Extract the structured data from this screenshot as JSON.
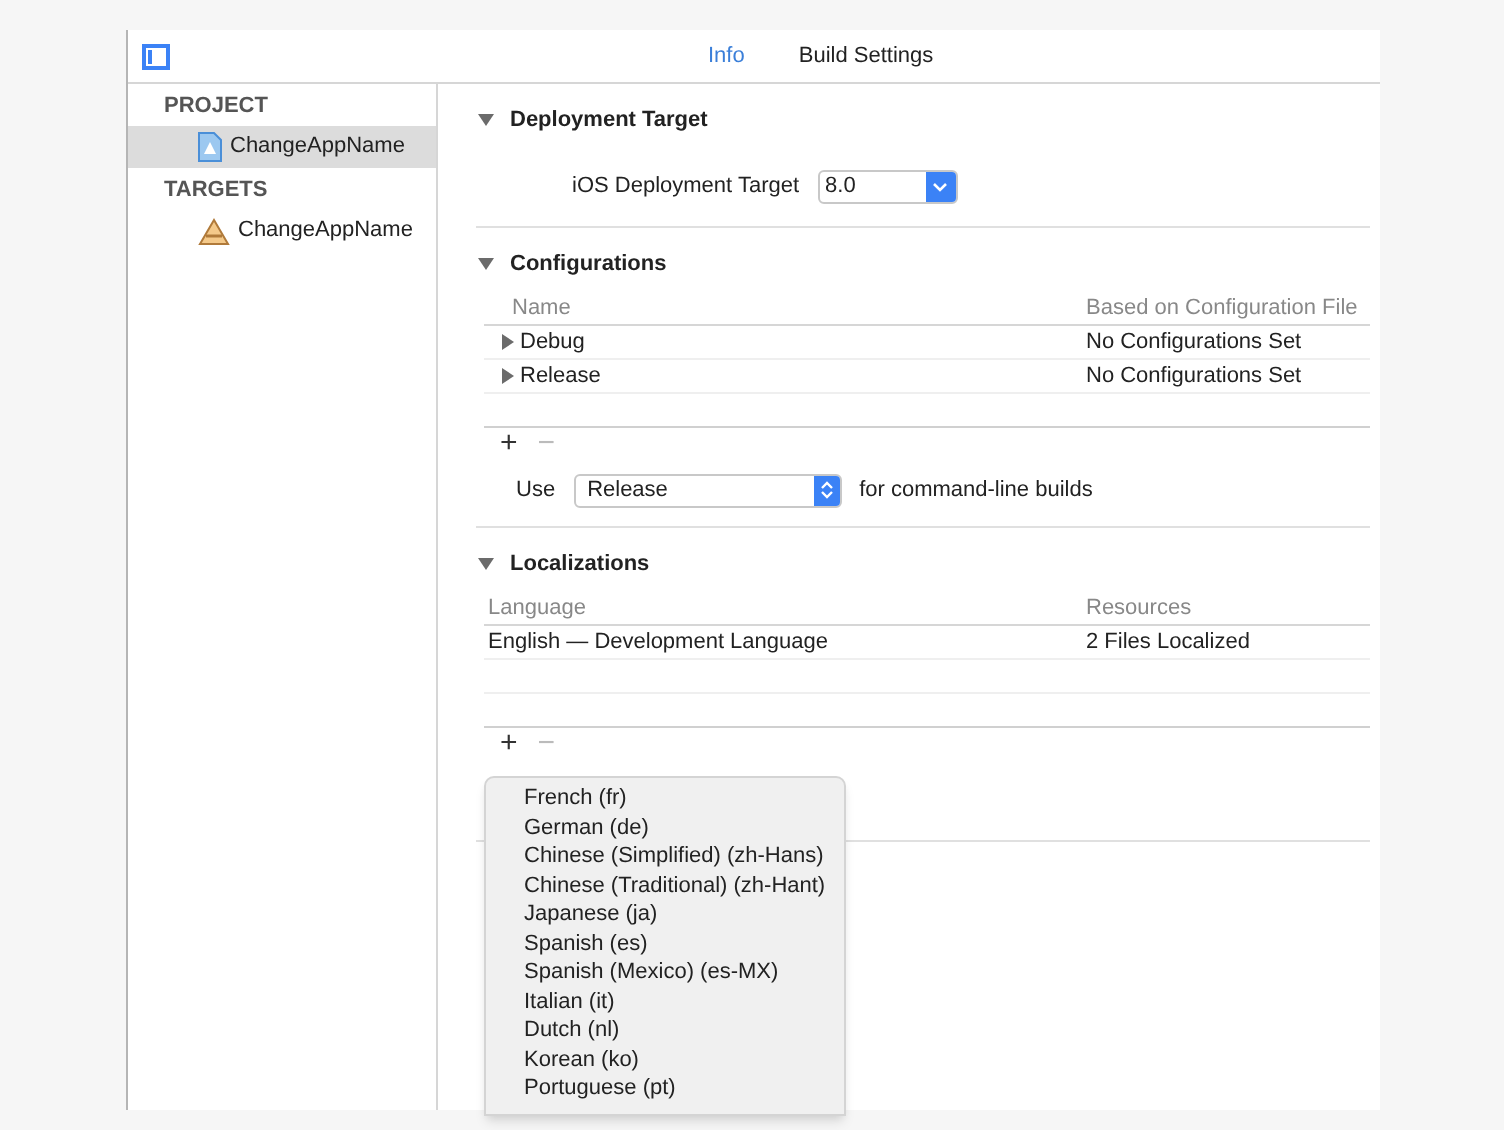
{
  "tabs": [
    {
      "label": "Info",
      "selected": true
    },
    {
      "label": "Build Settings",
      "selected": false
    }
  ],
  "sidebar": {
    "groups": [
      {
        "title": "PROJECT",
        "items": [
          {
            "label": "ChangeAppName",
            "kind": "project",
            "selected": true
          }
        ]
      },
      {
        "title": "TARGETS",
        "items": [
          {
            "label": "ChangeAppName",
            "kind": "target",
            "selected": false
          }
        ]
      }
    ]
  },
  "deployment_target": {
    "title": "Deployment Target",
    "expanded": true,
    "label": "iOS Deployment Target",
    "value": "8.0"
  },
  "configurations": {
    "title": "Configurations",
    "expanded": true,
    "columns": [
      "Name",
      "Based on Configuration File"
    ],
    "rows": [
      {
        "name": "Debug",
        "file": "No Configurations Set",
        "expanded": false
      },
      {
        "name": "Release",
        "file": "No Configurations Set",
        "expanded": false
      }
    ],
    "add": "+",
    "remove": "−",
    "use_label": "Use",
    "use_value": "Release",
    "use_suffix": "for command-line builds"
  },
  "localizations": {
    "title": "Localizations",
    "expanded": true,
    "columns": [
      "Language",
      "Resources"
    ],
    "rows": [
      {
        "language": "English — Development Language",
        "resources": "2 Files Localized"
      }
    ],
    "add": "+",
    "remove": "−"
  },
  "language_menu": [
    "French (fr)",
    "German (de)",
    "Chinese (Simplified) (zh-Hans)",
    "Chinese (Traditional) (zh-Hant)",
    "Japanese (ja)",
    "Spanish (es)",
    "Spanish (Mexico) (es-MX)",
    "Italian (it)",
    "Dutch (nl)",
    "Korean (ko)",
    "Portuguese (pt)"
  ]
}
